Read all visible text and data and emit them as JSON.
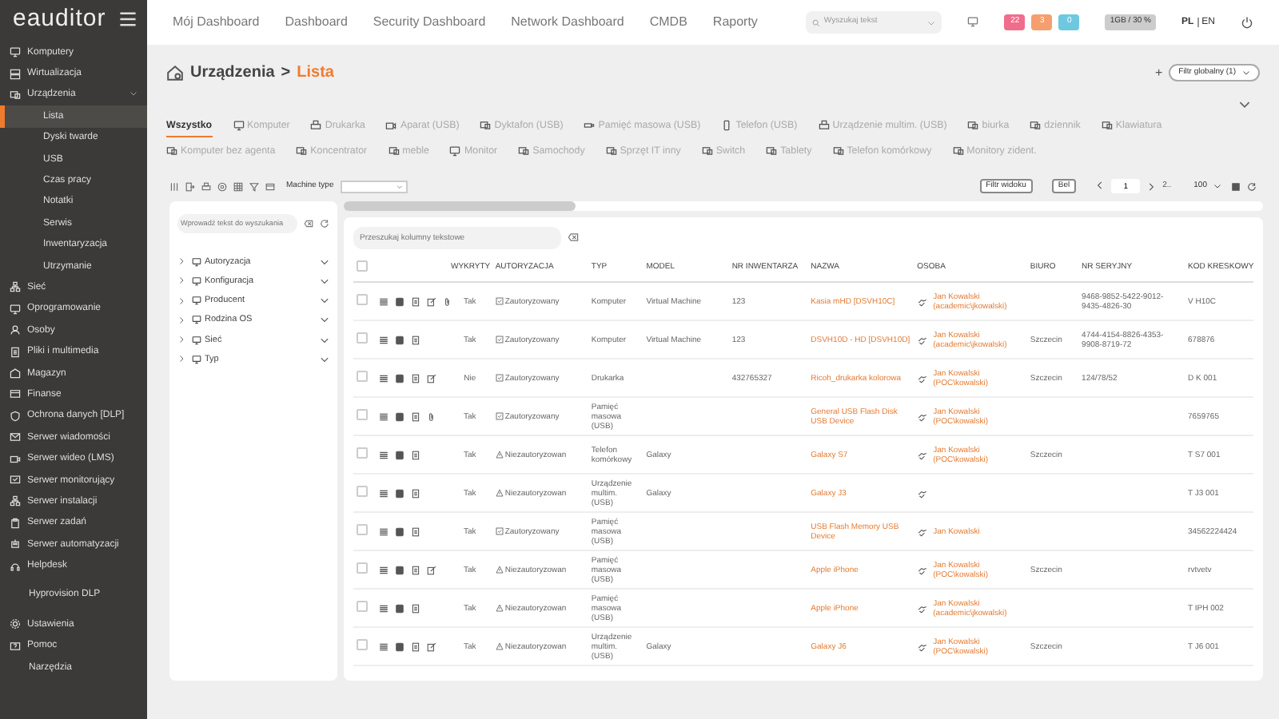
{
  "logo": "eauditor",
  "sidebar": {
    "items": [
      {
        "label": "Komputery",
        "selected": false
      },
      {
        "label": "Wirtualizacja",
        "selected": false
      },
      {
        "label": "Urządzenia",
        "selected": false,
        "expanded": true,
        "children": [
          {
            "label": "Lista",
            "selected": true
          },
          {
            "label": "Dyski twarde",
            "selected": false
          },
          {
            "label": "USB",
            "selected": false
          },
          {
            "label": "Czas pracy",
            "selected": false
          },
          {
            "label": "Notatki",
            "selected": false
          },
          {
            "label": "Serwis",
            "selected": false
          },
          {
            "label": "Inwentaryzacja",
            "selected": false
          },
          {
            "label": "Utrzymanie",
            "selected": false
          }
        ]
      },
      {
        "label": "Sieć",
        "selected": false
      },
      {
        "label": "Oprogramowanie",
        "selected": false
      },
      {
        "label": "Osoby",
        "selected": false
      },
      {
        "label": "Pliki i multimedia",
        "selected": false
      },
      {
        "label": "Magazyn",
        "selected": false
      },
      {
        "label": "Finanse",
        "selected": false
      },
      {
        "label": "Ochrona danych [DLP]",
        "selected": false
      },
      {
        "label": "Serwer wiadomości",
        "selected": false
      },
      {
        "label": "Serwer wideo (LMS)",
        "selected": false
      },
      {
        "label": "Serwer monitorujący",
        "selected": false
      },
      {
        "label": "Serwer instalacji",
        "selected": false
      },
      {
        "label": "Serwer zadań",
        "selected": false
      },
      {
        "label": "Serwer automatyzacji",
        "selected": false
      },
      {
        "label": "Helpdesk",
        "selected": false
      },
      {
        "label": "Hyprovision DLP",
        "selected": false
      },
      {
        "label": "Ustawienia",
        "selected": false
      },
      {
        "label": "Pomoc",
        "selected": false
      },
      {
        "label": "Narzędzia",
        "selected": false
      }
    ]
  },
  "top_nav": {
    "links": [
      "Mój Dashboard",
      "Dashboard",
      "Security Dashboard",
      "Network Dashboard",
      "CMDB",
      "Raporty"
    ],
    "search": {
      "placeholder": "Wyszukaj tekst"
    },
    "badges": [
      {
        "text": "22",
        "color": "#f06d8c"
      },
      {
        "text": "3",
        "color": "#f59f6e"
      },
      {
        "text": "0",
        "color": "#6ec8e0"
      }
    ],
    "usage": "1GB / 30 %",
    "languages": [
      {
        "label": "PL",
        "selected": true
      },
      {
        "label": "EN",
        "selected": false
      }
    ]
  },
  "breadcrumb": {
    "section": "Urządzenia",
    "separator": ">",
    "current": "Lista"
  },
  "global_filter": {
    "add": "+",
    "label": "Filtr globalny (1)"
  },
  "tabs": [
    {
      "label": "Wszystko",
      "selected": true
    },
    {
      "label": "Komputer",
      "selected": false
    },
    {
      "label": "Drukarka",
      "selected": false
    },
    {
      "label": "Aparat (USB)",
      "selected": false
    },
    {
      "label": "Dyktafon (USB)",
      "selected": false
    },
    {
      "label": "Pamięć masowa (USB)",
      "selected": false
    },
    {
      "label": "Telefon (USB)",
      "selected": false
    },
    {
      "label": "Urządzenie multim. (USB)",
      "selected": false
    },
    {
      "label": "biurka",
      "selected": false
    },
    {
      "label": "dziennik",
      "selected": false
    },
    {
      "label": "Klawiatura",
      "selected": false
    },
    {
      "label": "Komputer bez agenta",
      "selected": false
    },
    {
      "label": "Koncentrator",
      "selected": false
    },
    {
      "label": "meble",
      "selected": false
    },
    {
      "label": "Monitor",
      "selected": false
    },
    {
      "label": "Samochody",
      "selected": false
    },
    {
      "label": "Sprzęt IT inny",
      "selected": false
    },
    {
      "label": "Switch",
      "selected": false
    },
    {
      "label": "Tablety",
      "selected": false
    },
    {
      "label": "Telefon komórkowy",
      "selected": false
    },
    {
      "label": "Monitory zident.",
      "selected": false
    }
  ],
  "toolbar": {
    "machine_type_label": "Machine type",
    "view_filter": "Filtr widoku",
    "bel": "Bel",
    "page": "1",
    "next_pages": "2..",
    "page_size": "100"
  },
  "filter_panel": {
    "search_placeholder": "Wprowadź tekst do wyszukania",
    "tree": [
      "Autoryzacja",
      "Konfiguracja",
      "Producent",
      "Rodzina OS",
      "Sieć",
      "Typ"
    ]
  },
  "table": {
    "search_placeholder": "Przeszukaj kolumny tekstowe",
    "select_all_checked": false,
    "columns": [
      "WYKRYTY",
      "AUTORYZACJA",
      "TYP",
      "MODEL",
      "NR INWENTARZA",
      "NAZWA",
      "OSOBA",
      "BIURO",
      "NR SERYJNY",
      "KOD KRESKOWY"
    ],
    "rows": [
      {
        "checked": false,
        "detected": "Tak",
        "authorized": true,
        "authorization": "Zautoryzowany",
        "type": "Komputer",
        "model": "Virtual Machine",
        "inventory": "123",
        "name": "Kasia mHD [DSVH10C]",
        "person": "Jan Kowalski (academic\\jkowalski)",
        "office": "",
        "serial": "9468-9852-5422-9012-9435-4826-30",
        "barcode": "V H10C"
      },
      {
        "checked": false,
        "detected": "Tak",
        "authorized": true,
        "authorization": "Zautoryzowany",
        "type": "Komputer",
        "model": "Virtual Machine",
        "inventory": "123",
        "name": "DSVH10D - HD [DSVH10D]",
        "person": "Jan Kowalski (academic\\jkowalski)",
        "office": "Szczecin",
        "serial": "4744-4154-8826-4353-9908-8719-72",
        "barcode": "678876"
      },
      {
        "checked": false,
        "detected": "Nie",
        "authorized": true,
        "authorization": "Zautoryzowany",
        "type": "Drukarka",
        "model": "",
        "inventory": "432765327",
        "name": "Ricoh_drukarka kolorowa",
        "person": "Jan Kowalski (POC\\kowalski)",
        "office": "Szczecin",
        "serial": "124/78/52",
        "barcode": "D K 001"
      },
      {
        "checked": false,
        "detected": "Tak",
        "authorized": true,
        "authorization": "Zautoryzowany",
        "type": "Pamięć masowa (USB)",
        "model": "",
        "inventory": "",
        "name": "General USB Flash Disk USB Device",
        "person": "Jan Kowalski (POC\\kowalski)",
        "office": "",
        "serial": "",
        "barcode": "7659765"
      },
      {
        "checked": false,
        "detected": "Tak",
        "authorized": false,
        "authorization": "Niezautoryzowan",
        "type": "Telefon komórkowy",
        "model": "Galaxy",
        "inventory": "",
        "name": "Galaxy S7",
        "person": "Jan Kowalski (POC\\kowalski)",
        "office": "Szczecin",
        "serial": "",
        "barcode": "T S7 001"
      },
      {
        "checked": false,
        "detected": "Tak",
        "authorized": false,
        "authorization": "Niezautoryzowan",
        "type": "Urządzenie multim. (USB)",
        "model": "Galaxy",
        "inventory": "",
        "name": "Galaxy J3",
        "person": "",
        "office": "",
        "serial": "",
        "barcode": "T J3 001"
      },
      {
        "checked": false,
        "detected": "Tak",
        "authorized": true,
        "authorization": "Zautoryzowany",
        "type": "Pamięć masowa (USB)",
        "model": "",
        "inventory": "",
        "name": "USB Flash Memory USB Device",
        "person": "Jan Kowalski",
        "office": "",
        "serial": "",
        "barcode": "34562224424"
      },
      {
        "checked": false,
        "detected": "Tak",
        "authorized": false,
        "authorization": "Niezautoryzowan",
        "type": "Pamięć masowa (USB)",
        "model": "",
        "inventory": "",
        "name": "Apple iPhone",
        "person": "Jan Kowalski (POC\\kowalski)",
        "office": "Szczecin",
        "serial": "",
        "barcode": "rvtvetv"
      },
      {
        "checked": false,
        "detected": "Tak",
        "authorized": false,
        "authorization": "Niezautoryzowan",
        "type": "Pamięć masowa (USB)",
        "model": "",
        "inventory": "",
        "name": "Apple iPhone",
        "person": "Jan Kowalski (academic\\jkowalski)",
        "office": "",
        "serial": "",
        "barcode": "T IPH 002"
      },
      {
        "checked": false,
        "detected": "Tak",
        "authorized": false,
        "authorization": "Niezautoryzowan",
        "type": "Urządzenie multim. (USB)",
        "model": "Galaxy",
        "inventory": "",
        "name": "Galaxy J6",
        "person": "Jan Kowalski (POC\\kowalski)",
        "office": "Szczecin",
        "serial": "",
        "barcode": "T J6 001"
      }
    ]
  }
}
